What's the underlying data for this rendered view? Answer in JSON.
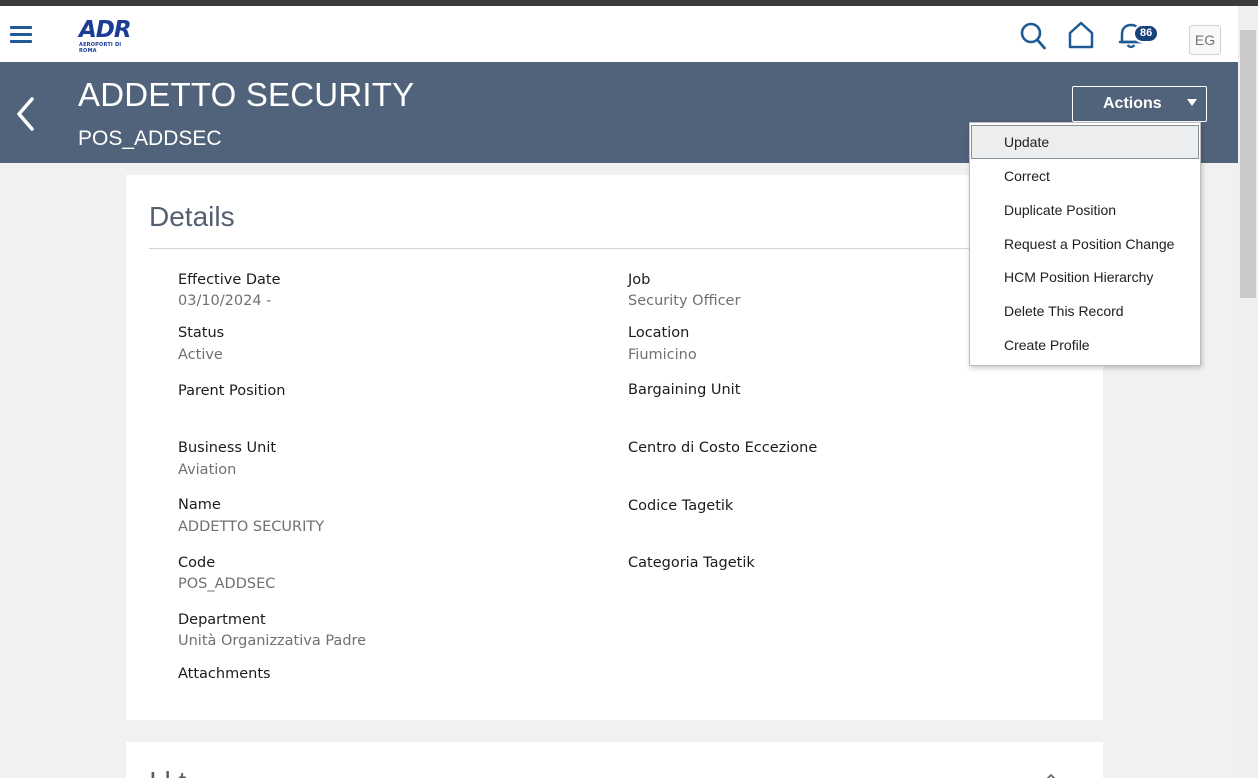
{
  "topbar": {
    "logo_text": "ADR",
    "logo_subtext": "AEROPORTI DI ROMA",
    "notification_count": "86",
    "avatar_initials": "EG"
  },
  "header": {
    "title": "ADDETTO SECURITY",
    "subtitle": "POS_ADDSEC",
    "actions_label": "Actions",
    "background_color": "#51637a"
  },
  "actions_menu": {
    "items": [
      {
        "label": "Update",
        "highlighted": true
      },
      {
        "label": "Correct"
      },
      {
        "label": "Duplicate Position"
      },
      {
        "label": "Request a Position Change"
      },
      {
        "label": "HCM Position Hierarchy"
      },
      {
        "label": "Delete This Record"
      },
      {
        "label": "Create Profile"
      }
    ]
  },
  "details": {
    "title": "Details",
    "left": [
      {
        "label": "Effective Date",
        "value": "03/10/2024 -"
      },
      {
        "label": "Status",
        "value": "Active"
      },
      {
        "label": "Parent Position",
        "value": ""
      },
      {
        "label": "Business Unit",
        "value": "Aviation"
      },
      {
        "label": "Name",
        "value": "ADDETTO SECURITY"
      },
      {
        "label": "Code",
        "value": "POS_ADDSEC"
      },
      {
        "label": "Department",
        "value": "Unità Organizzativa Padre"
      },
      {
        "label": "Attachments",
        "value": ""
      }
    ],
    "right": [
      {
        "label": "Job",
        "value": "Security Officer"
      },
      {
        "label": "Location",
        "value": "Fiumicino"
      },
      {
        "label": "Bargaining Unit",
        "value": ""
      },
      {
        "label": "Centro di Costo Eccezione",
        "value": ""
      },
      {
        "label": "Codice Tagetik",
        "value": ""
      },
      {
        "label": "Categoria Tagetik",
        "value": ""
      }
    ]
  },
  "next_section": {
    "title": "I     l     t"
  },
  "icons": {
    "menu": "hamburger-icon",
    "search": "search-icon",
    "home": "home-icon",
    "notifications": "bell-icon",
    "back": "chevron-left-icon",
    "dropdown": "caret-down-icon",
    "collapse": "chevron-up-icon"
  }
}
